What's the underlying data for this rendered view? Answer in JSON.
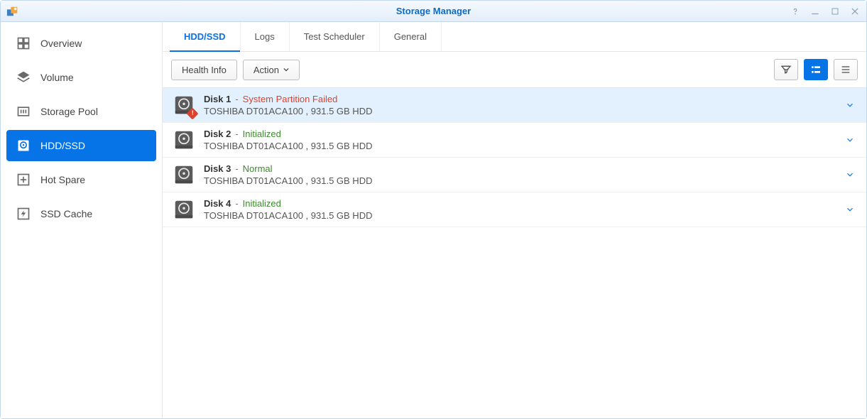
{
  "window": {
    "title": "Storage Manager"
  },
  "sidebar": {
    "items": [
      {
        "label": "Overview",
        "active": false,
        "icon": "overview"
      },
      {
        "label": "Volume",
        "active": false,
        "icon": "volume"
      },
      {
        "label": "Storage Pool",
        "active": false,
        "icon": "pool"
      },
      {
        "label": "HDD/SSD",
        "active": true,
        "icon": "hdd"
      },
      {
        "label": "Hot Spare",
        "active": false,
        "icon": "spare"
      },
      {
        "label": "SSD Cache",
        "active": false,
        "icon": "cache"
      }
    ]
  },
  "tabs": [
    {
      "label": "HDD/SSD",
      "active": true
    },
    {
      "label": "Logs",
      "active": false
    },
    {
      "label": "Test Scheduler",
      "active": false
    },
    {
      "label": "General",
      "active": false
    }
  ],
  "toolbar": {
    "health_info": "Health Info",
    "action": "Action"
  },
  "disks": [
    {
      "name": "Disk 1",
      "status": "System Partition Failed",
      "status_class": "failed",
      "details": "TOSHIBA DT01ACA100 , 931.5 GB HDD",
      "selected": true,
      "warning": true
    },
    {
      "name": "Disk 2",
      "status": "Initialized",
      "status_class": "initialized",
      "details": "TOSHIBA DT01ACA100 , 931.5 GB HDD",
      "selected": false,
      "warning": false
    },
    {
      "name": "Disk 3",
      "status": "Normal",
      "status_class": "normal",
      "details": "TOSHIBA DT01ACA100 , 931.5 GB HDD",
      "selected": false,
      "warning": false
    },
    {
      "name": "Disk 4",
      "status": "Initialized",
      "status_class": "initialized",
      "details": "TOSHIBA DT01ACA100 , 931.5 GB HDD",
      "selected": false,
      "warning": false
    }
  ]
}
